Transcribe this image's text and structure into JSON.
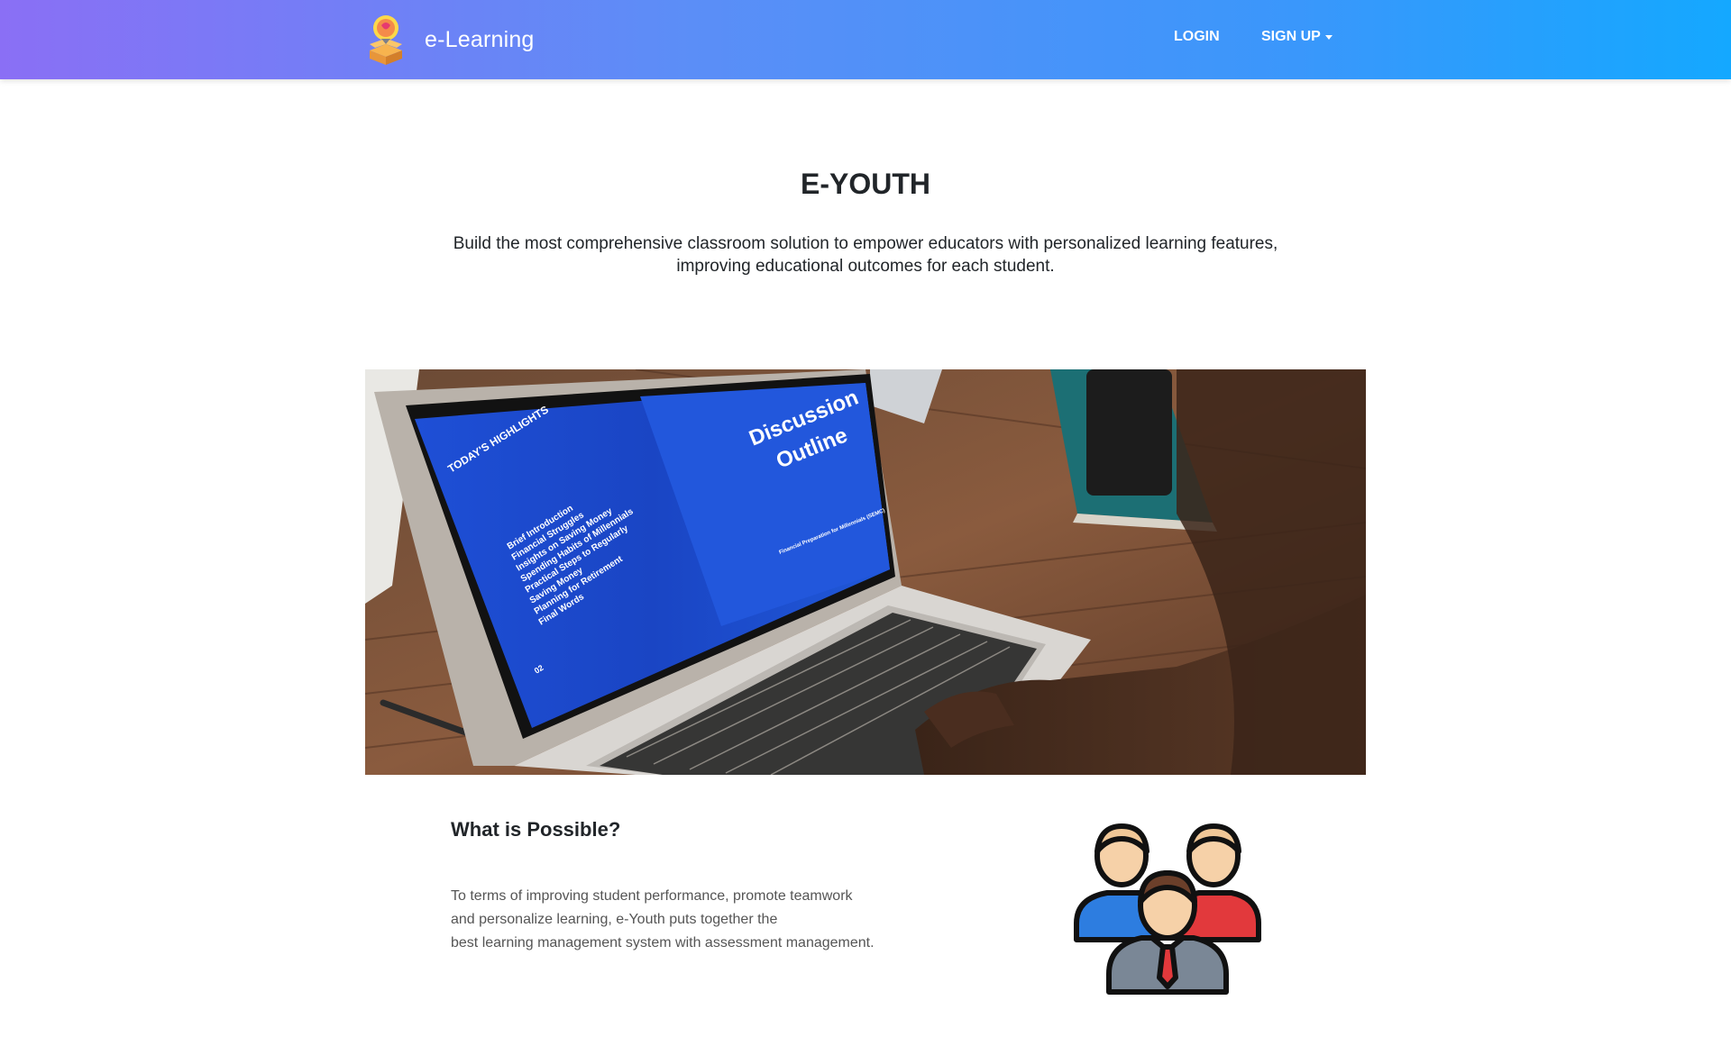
{
  "nav": {
    "brand_name": "e-Learning",
    "login_label": "LOGIN",
    "signup_label": "SIGN UP"
  },
  "hero": {
    "title": "E-YOUTH",
    "subtitle_line1": "Build the most comprehensive classroom solution to empower educators with personalized learning features,",
    "subtitle_line2": "improving educational outcomes for each student."
  },
  "photo": {
    "screen_left_heading": "TODAY'S HIGHLIGHTS",
    "screen_items": [
      "Brief Introduction",
      "Financial Struggles",
      "Insights on Saving Money",
      "Spending Habits of Millennials",
      "Practical Steps to Regularly",
      "Saving Money",
      "Planning for Retirement",
      "Final Words"
    ],
    "screen_page_number": "02",
    "screen_right_title_line1": "Discussion",
    "screen_right_title_line2": "Outline",
    "screen_right_caption": "Financial Preparation for Millennials (SEMC)"
  },
  "possible": {
    "title": "What is Possible?",
    "body_line1": "To terms of improving student performance, promote teamwork",
    "body_line2": "and personalize learning, e-Youth puts together the",
    "body_line3": "best learning management system with assessment management."
  },
  "colors": {
    "nav_gradient_start": "#8a6ff5",
    "nav_gradient_end": "#14a8ff",
    "screen_blue": "#1f4fd1"
  },
  "icons": {
    "brand": "lightbulb-box-icon",
    "signup_caret": "caret-down-icon",
    "illustration": "team-people-icon"
  }
}
